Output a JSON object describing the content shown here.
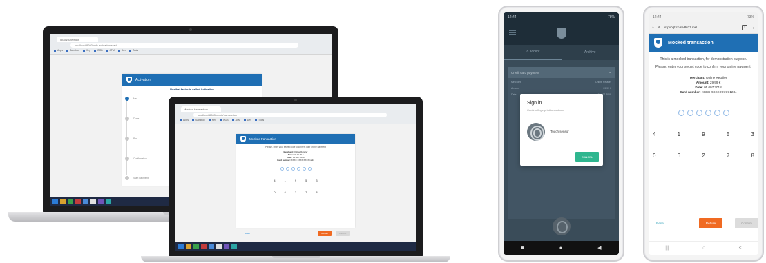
{
  "laptop1": {
    "tab_label": "Touch/Activation",
    "url": "localhost:8080/oob-activation/start",
    "bookmarks": [
      "Apps",
      "Sandbox",
      "Key",
      "OOB",
      "ATM",
      "Dev",
      "Tools"
    ],
    "activation": {
      "title": "Activation",
      "subtitle": "Nexthai faster is called Activation",
      "steps": [
        "Me",
        "Done",
        "Pin",
        "Confirmation",
        "Start payment"
      ]
    }
  },
  "laptop2": {
    "tab_label": "Mocked transaction",
    "url": "localhost:8080/mock/transaction",
    "bookmarks": [
      "Apps",
      "Sandbox",
      "Key",
      "OOB",
      "ATM",
      "Dev",
      "Tools"
    ],
    "transaction": {
      "title": "Mocked transaction",
      "prompt": "Please, enter your secret code to confirm your online payment",
      "merchant_label": "Merchant:",
      "merchant": "Online Retailer",
      "amount_label": "Amount:",
      "amount": "29.99 €",
      "date_label": "Date:",
      "date": "05.007.2018",
      "card_label": "Card number:",
      "card": "XXXX XXXX XXXX 1234",
      "digit_row1": [
        "4",
        "1",
        "9",
        "5",
        "3"
      ],
      "digit_row2": [
        "0",
        "6",
        "2",
        "7",
        "8"
      ],
      "reset": "Reset",
      "refuse": "Refuse",
      "confirm": "Confirm"
    }
  },
  "phone1": {
    "time": "12:44",
    "battery": "78%",
    "tabs": [
      "To accept",
      "Archive"
    ],
    "card_title": "Credit card payment",
    "card_lines": [
      [
        "Merchant",
        "Online Retailer"
      ],
      [
        "Amount",
        "29.99 €"
      ],
      [
        "Date",
        "05.007.2018"
      ]
    ],
    "dialog_title": "Sign in",
    "dialog_sub": "Confirm fingerprint to continue",
    "touch_label": "Touch sensor",
    "cancel": "CANCEL",
    "nav": [
      "■",
      "●",
      "◀"
    ]
  },
  "phone2": {
    "time": "12:44",
    "battery": "73%",
    "url": "ic.pubqf.co.se/8677.mel",
    "tabs_count": "1",
    "title": "Mocked transaction",
    "intro": "This is a mocked transaction, for demonstration purpose.",
    "prompt": "Please, enter your secret code to confirm your online payment:",
    "merchant_label": "Merchant:",
    "merchant": "Online Retailer",
    "amount_label": "Amount:",
    "amount": "29.99 €",
    "date_label": "Date:",
    "date": "05.007.2018",
    "card_label": "Card number:",
    "card": "XXXX XXXX XXXX 1234",
    "digit_row1": [
      "4",
      "1",
      "9",
      "5",
      "3"
    ],
    "digit_row2": [
      "0",
      "6",
      "2",
      "7",
      "8"
    ],
    "reset": "Reset",
    "refuse": "Refuse",
    "confirm": "Confirm",
    "nav": [
      "|||",
      "○",
      "<"
    ]
  }
}
